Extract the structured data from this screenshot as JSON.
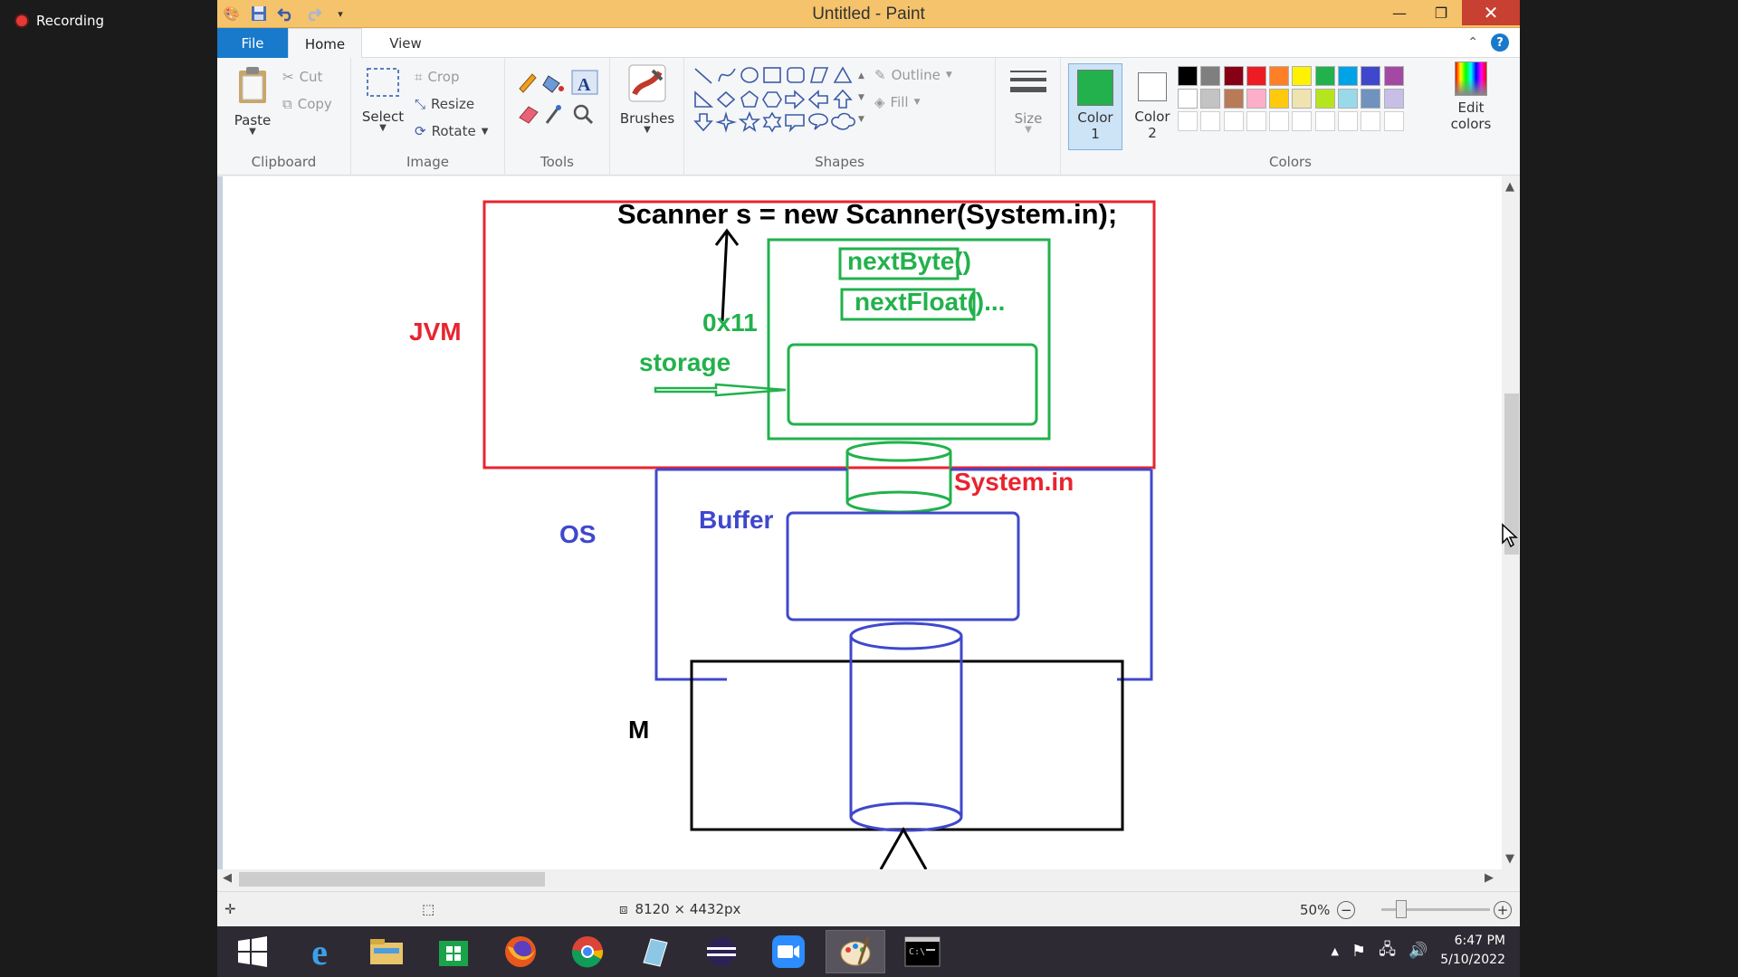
{
  "overlay": {
    "recording_label": "Recording"
  },
  "window": {
    "title": "Untitled - Paint"
  },
  "tabs": {
    "file": "File",
    "home": "Home",
    "view": "View"
  },
  "ribbon": {
    "clipboard": {
      "paste": "Paste",
      "cut": "Cut",
      "copy": "Copy",
      "label": "Clipboard"
    },
    "image": {
      "select": "Select",
      "crop": "Crop",
      "resize": "Resize",
      "rotate": "Rotate",
      "label": "Image"
    },
    "tools": {
      "label": "Tools"
    },
    "brushes": {
      "label": "Brushes"
    },
    "shapes": {
      "outline": "Outline",
      "fill": "Fill",
      "label": "Shapes"
    },
    "size": {
      "label": "Size"
    },
    "colors": {
      "color1_label": "Color",
      "color1_num": "1",
      "color2_label": "Color",
      "color2_num": "2",
      "edit_label_1": "Edit",
      "edit_label_2": "colors",
      "label": "Colors",
      "color1_value": "#22b14c",
      "color2_value": "#ffffff",
      "palette_row1": [
        "#000000",
        "#7f7f7f",
        "#880015",
        "#ed1c24",
        "#ff7f27",
        "#fff200",
        "#22b14c",
        "#00a2e8",
        "#3f48cc",
        "#a349a4"
      ],
      "palette_row2": [
        "#ffffff",
        "#c3c3c3",
        "#b97a57",
        "#ffaec9",
        "#ffc90e",
        "#efe4b0",
        "#b5e61d",
        "#99d9ea",
        "#7092be",
        "#c8bfe7"
      ]
    }
  },
  "drawing": {
    "code_line": "Scanner s = new Scanner(System.in);",
    "jvm": "JVM",
    "method1": "nextByte()",
    "method2": "nextFloat()...",
    "address": "0x11",
    "storage": "storage",
    "system_in": "System.in",
    "os": "OS",
    "buffer": "Buffer",
    "m": "M"
  },
  "status": {
    "dimensions": "8120 × 4432px",
    "zoom": "50%"
  },
  "taskbar": {
    "apps": [
      "start-icon",
      "ie-icon",
      "file-explorer-icon",
      "store-icon",
      "firefox-icon",
      "chrome-icon",
      "notepad-icon",
      "eclipse-icon",
      "zoom-icon",
      "paint-icon",
      "cmd-icon"
    ]
  },
  "clock": {
    "time": "6:47 PM",
    "date": "5/10/2022"
  }
}
